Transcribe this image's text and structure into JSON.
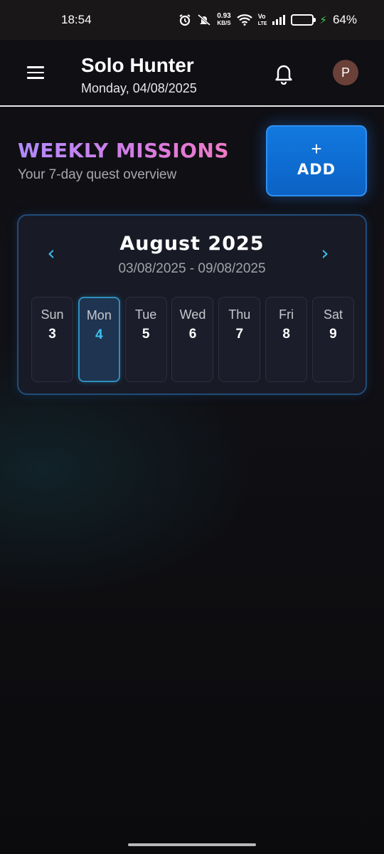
{
  "status_bar": {
    "time": "18:54",
    "net_speed_value": "0.93",
    "net_speed_unit": "KB/S",
    "volte_top": "Vo",
    "volte_bottom": "LTE",
    "battery_percent": "64%",
    "battery_level": 0.64,
    "icons": [
      "alarm-icon",
      "mute-icon",
      "wifi-icon",
      "signal-icon",
      "battery-icon",
      "charging-icon"
    ]
  },
  "header": {
    "title": "Solo Hunter",
    "date": "Monday, 04/08/2025",
    "avatar_initial": "P",
    "avatar_color": "#6a4038"
  },
  "missions": {
    "title": "WEEKLY MISSIONS",
    "subtitle": "Your 7-day quest overview",
    "add_plus": "+",
    "add_label": "ADD"
  },
  "calendar": {
    "month": "August 2025",
    "range": "03/08/2025 - 09/08/2025",
    "days": [
      {
        "name": "Sun",
        "num": "3"
      },
      {
        "name": "Mon",
        "num": "4"
      },
      {
        "name": "Tue",
        "num": "5"
      },
      {
        "name": "Wed",
        "num": "6"
      },
      {
        "name": "Thu",
        "num": "7"
      },
      {
        "name": "Fri",
        "num": "8"
      },
      {
        "name": "Sat",
        "num": "9"
      }
    ],
    "selected_index": 1,
    "accent_color": "#3dc2ef"
  }
}
